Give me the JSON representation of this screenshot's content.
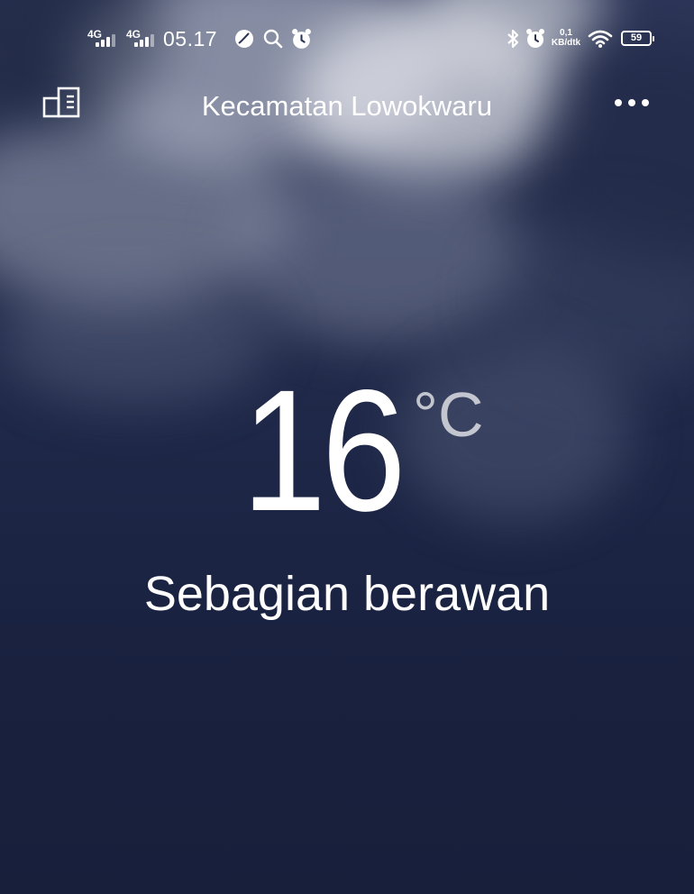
{
  "status_bar": {
    "sim1_label": "4G",
    "sim2_label": "4G",
    "time": "05.17",
    "net_speed_value": "0,1",
    "net_speed_unit": "KB/dtk",
    "battery_level": "59",
    "icons": [
      "leaf-icon",
      "search-icon",
      "alarm-icon",
      "bluetooth-icon",
      "alarm-icon",
      "wifi-icon",
      "battery-icon"
    ]
  },
  "header": {
    "location": "Kecamatan Lowokwaru",
    "left_icon": "city-list-icon",
    "right_icon": "more-icon"
  },
  "weather": {
    "temperature": "16",
    "unit": "°C",
    "condition": "Sebagian berawan"
  },
  "colors": {
    "background_top": "#2d3658",
    "background_bottom": "#171f3b",
    "text": "#ffffff"
  }
}
